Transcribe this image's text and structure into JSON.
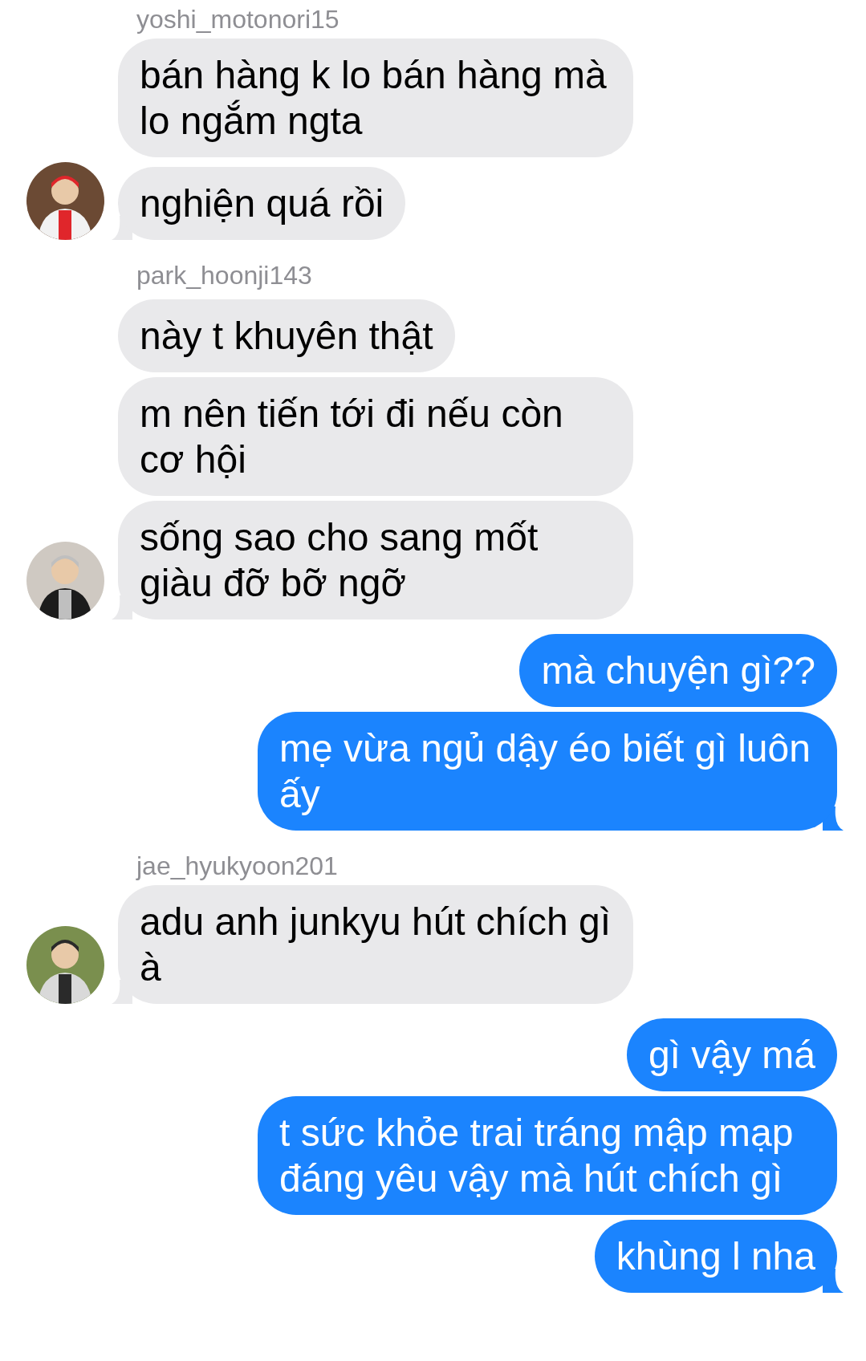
{
  "groups": [
    {
      "kind": "received",
      "sender": "yoshi_motonori15",
      "bubbles": [
        "bán hàng k lo bán hàng mà lo ngắm ngta",
        "nghiện quá rồi"
      ]
    },
    {
      "kind": "received",
      "sender": "park_hoonji143",
      "bubbles": [
        "này t khuyên thật",
        "m nên tiến tới đi nếu còn cơ hội",
        "sống sao cho sang mốt giàu đỡ bỡ ngỡ"
      ]
    },
    {
      "kind": "sent",
      "bubbles": [
        "mà chuyện gì??",
        "mẹ vừa ngủ dậy éo biết gì luôn ấy"
      ]
    },
    {
      "kind": "received",
      "sender": "jae_hyukyoon201",
      "bubbles": [
        "adu anh junkyu hút chích gì à"
      ]
    },
    {
      "kind": "sent",
      "bubbles": [
        "gì vậy má",
        "t sức khỏe trai tráng mập mạp đáng yêu vậy mà hút chích gì",
        "khùng l nha"
      ]
    }
  ]
}
